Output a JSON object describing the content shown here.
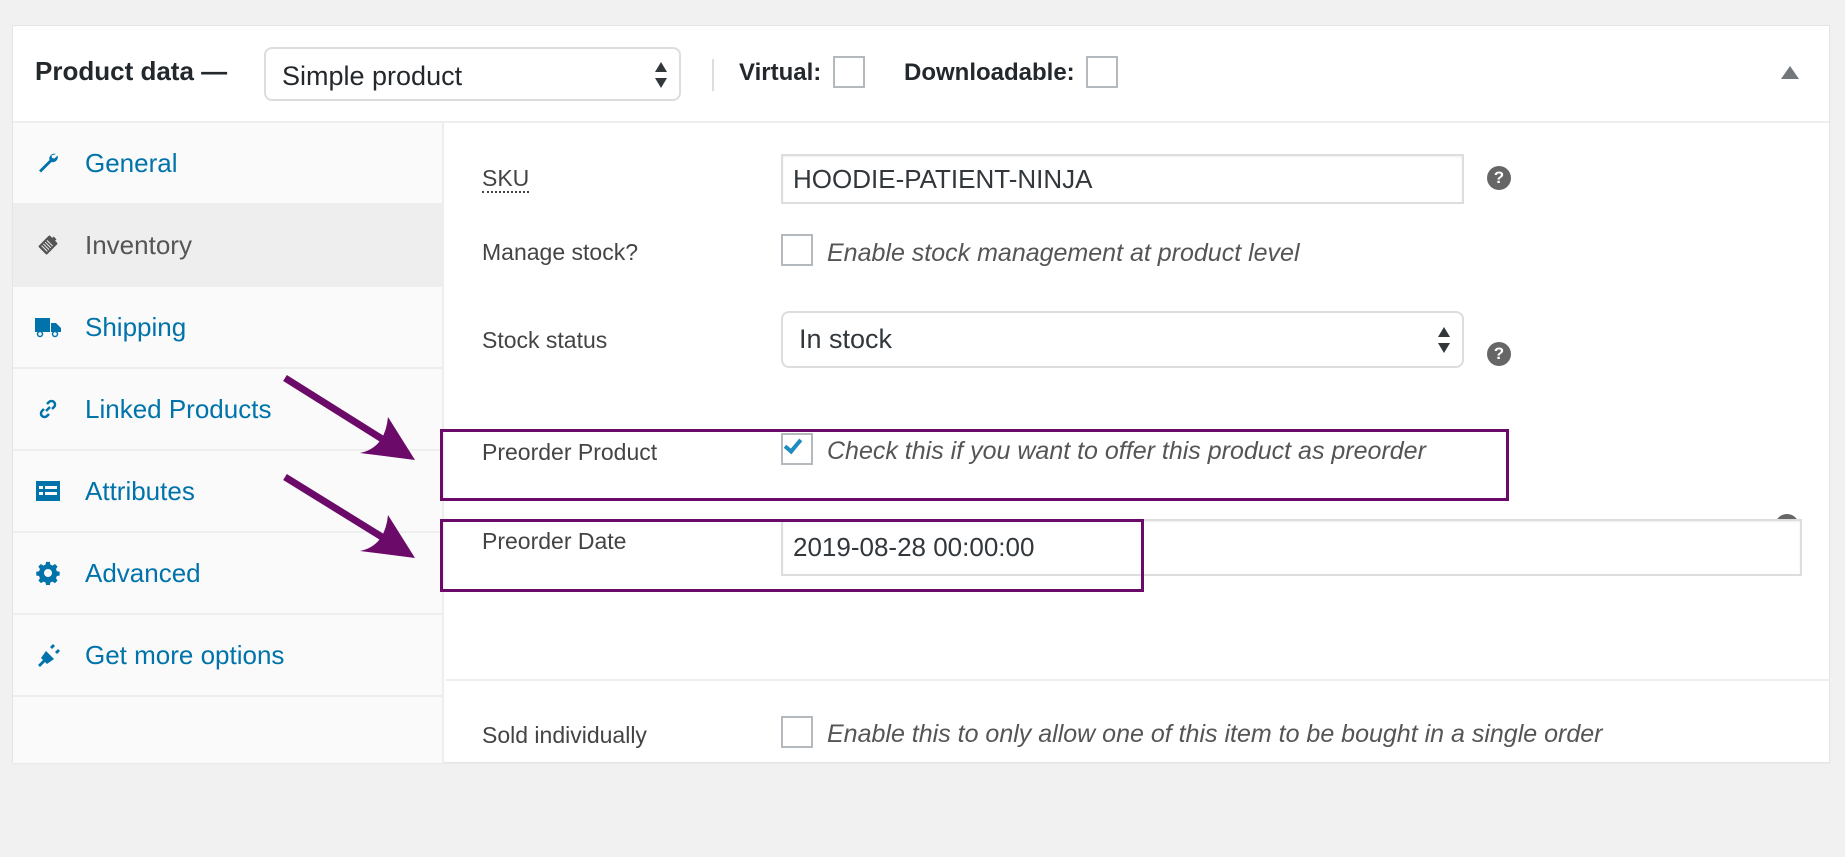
{
  "header": {
    "title": "Product data —",
    "product_type": "Simple product",
    "virtual_label": "Virtual:",
    "virtual_checked": false,
    "downloadable_label": "Downloadable:",
    "downloadable_checked": false
  },
  "sidebar": {
    "items": [
      {
        "label": "General",
        "icon": "wrench-icon",
        "active": false
      },
      {
        "label": "Inventory",
        "icon": "tag-icon",
        "active": true
      },
      {
        "label": "Shipping",
        "icon": "truck-icon",
        "active": false
      },
      {
        "label": "Linked Products",
        "icon": "link-icon",
        "active": false
      },
      {
        "label": "Attributes",
        "icon": "list-icon",
        "active": false
      },
      {
        "label": "Advanced",
        "icon": "gear-icon",
        "active": false
      },
      {
        "label": "Get more options",
        "icon": "plugin-icon",
        "active": false
      }
    ]
  },
  "inventory": {
    "sku_label": "SKU",
    "sku_value": "HOODIE-PATIENT-NINJA",
    "manage_stock_label": "Manage stock?",
    "manage_stock_desc": "Enable stock management at product level",
    "manage_stock_checked": false,
    "stock_status_label": "Stock status",
    "stock_status_value": "In stock",
    "preorder_label": "Preorder Product",
    "preorder_desc": "Check this if you want to offer this product as preorder",
    "preorder_checked": true,
    "preorder_date_label": "Preorder Date",
    "preorder_date_value": "2019-08-28 00:00:00",
    "sold_individually_label": "Sold individually",
    "sold_individually_desc": "Enable this to only allow one of this item to be bought in a single order",
    "sold_individually_checked": false,
    "help_glyph": "?"
  },
  "colors": {
    "link": "#0073aa",
    "highlight": "#6b0a69",
    "help": "#666666"
  }
}
